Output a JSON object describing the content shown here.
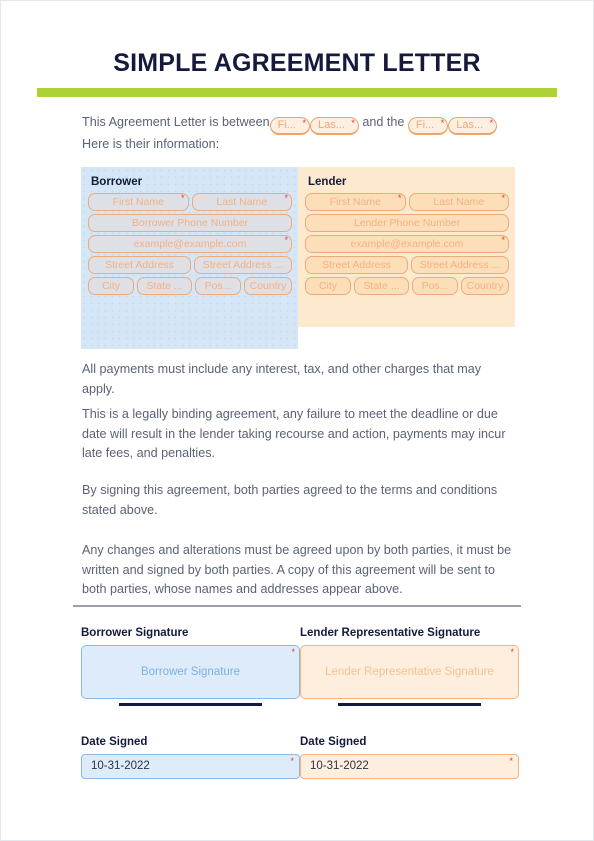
{
  "document": {
    "title": "SIMPLE AGREEMENT LETTER",
    "accent_green": "#aed136",
    "intro": {
      "lead": "This Agreement Letter is between",
      "middle": "and the",
      "tail": "Here is their information:",
      "inline_fields": [
        {
          "label": "Fi...",
          "required": "*"
        },
        {
          "label": "Las...",
          "required": "*"
        },
        {
          "label": "Fi...",
          "required": "*"
        },
        {
          "label": "Las...",
          "required": "*"
        }
      ]
    }
  },
  "borrower": {
    "heading": "Borrower",
    "first_name": "First Name",
    "last_name": "Last Name",
    "phone": "Borrower Phone Number",
    "email": "example@example.com",
    "street_address": "Street Address",
    "street_address_2": "Street Address ...",
    "city": "City",
    "state": "State ...",
    "postal": "Pos...",
    "country": "Country",
    "required_marker": "*",
    "panel_color": "#d5e6f7"
  },
  "lender": {
    "heading": "Lender",
    "first_name": "First Name",
    "last_name": "Last Name",
    "phone": "Lender Phone Number",
    "email": "example@example.com",
    "street_address": "Street Address",
    "street_address_2": "Street Address ...",
    "city": "City",
    "state": "State ...",
    "postal": "Pos...",
    "country": "Country",
    "required_marker": "*",
    "panel_color": "#fdeace"
  },
  "paragraphs": {
    "p1": "All payments must include any interest, tax, and other charges that may apply.",
    "p2": "This is a legally binding agreement, any failure to meet the deadline or due date will result in the lender taking recourse and action, payments may incur late fees, and penalties.",
    "p3": "By signing this agreement, both parties agreed to the terms and conditions stated above.",
    "p4": "Any changes and alterations must be agreed upon by both parties, it must be written and signed by both parties. A copy of this agreement will be sent to both parties, whose names and addresses appear above."
  },
  "signatures": {
    "borrower": {
      "label": "Borrower Signature",
      "placeholder": "Borrower Signature",
      "required_marker": "*"
    },
    "lender": {
      "label": "Lender Representative Signature",
      "placeholder": "Lender Representative Signature",
      "required_marker": "*"
    }
  },
  "dates": {
    "borrower": {
      "label": "Date Signed",
      "value": "10-31-2022",
      "required_marker": "*"
    },
    "lender": {
      "label": "Date Signed",
      "value": "10-31-2022",
      "required_marker": "*"
    }
  }
}
